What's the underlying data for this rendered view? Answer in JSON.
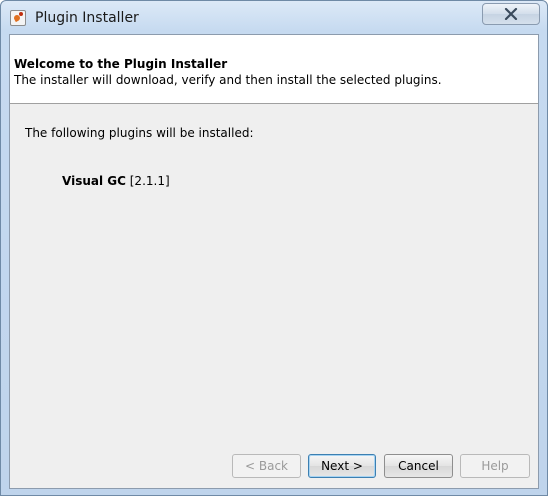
{
  "window": {
    "title": "Plugin Installer",
    "icon": "plugin-installer-icon",
    "close_icon": "close-icon"
  },
  "header": {
    "title": "Welcome to the Plugin Installer",
    "description": "The installer will download, verify and then install the selected plugins."
  },
  "body": {
    "intro": "The following plugins will be installed:",
    "plugins": [
      {
        "name": "Visual GC",
        "version": "[2.1.1]"
      }
    ]
  },
  "buttons": {
    "back": "< Back",
    "next": "Next >",
    "cancel": "Cancel",
    "help": "Help"
  },
  "colors": {
    "title_bar": "#c6daf0",
    "panel": "#efefef",
    "header_bg": "#ffffff",
    "default_button_border": "#3c7fb1"
  }
}
